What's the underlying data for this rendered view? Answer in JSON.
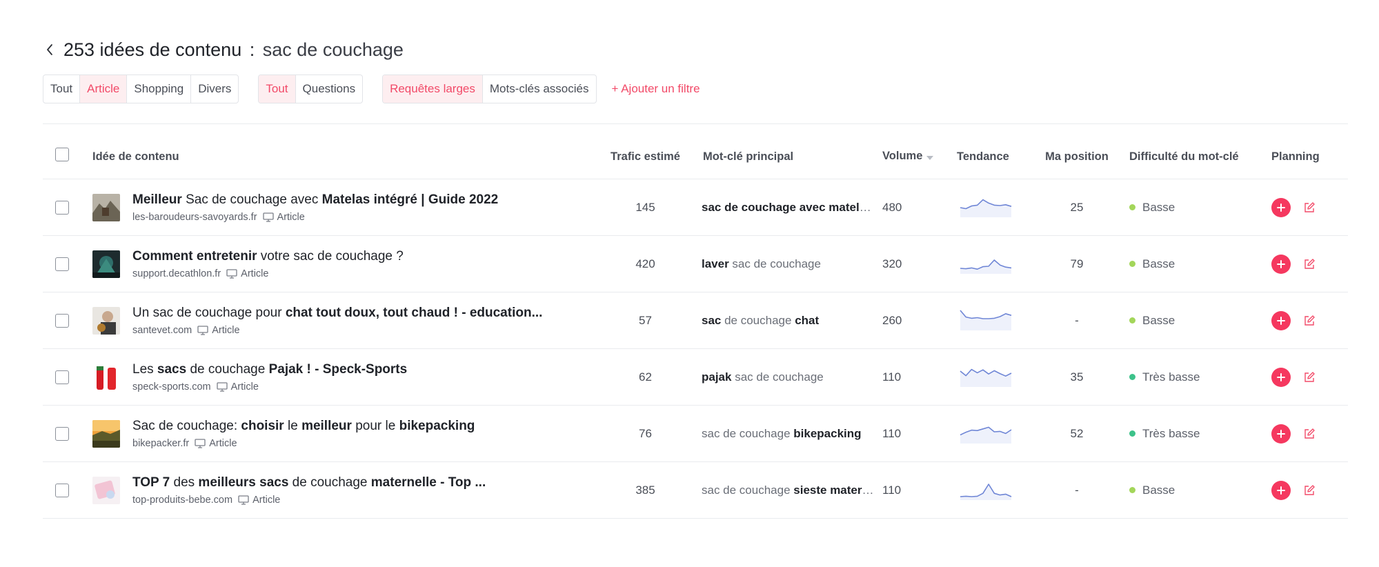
{
  "header": {
    "count": "253 idées de contenu",
    "separator": ":",
    "query": "sac de couchage"
  },
  "filters": {
    "type_group": [
      {
        "label": "Tout",
        "active": false
      },
      {
        "label": "Article",
        "active": true
      },
      {
        "label": "Shopping",
        "active": false
      },
      {
        "label": "Divers",
        "active": false
      }
    ],
    "question_group": [
      {
        "label": "Tout",
        "active": true
      },
      {
        "label": "Questions",
        "active": false
      }
    ],
    "scope_group": [
      {
        "label": "Requêtes larges",
        "active": true
      },
      {
        "label": "Mots-clés associés",
        "active": false
      }
    ],
    "add_filter": "+ Ajouter un filtre"
  },
  "columns": {
    "idea": "Idée de contenu",
    "traffic": "Trafic estimé",
    "keyword": "Mot-clé principal",
    "volume": "Volume",
    "trend": "Tendance",
    "position": "Ma position",
    "difficulty": "Difficulté du mot-clé",
    "planning": "Planning"
  },
  "colors": {
    "accent": "#f24a68",
    "plan_button": "#f5385f",
    "trend_line": "#6f86d6",
    "trend_fill": "#eef1fb",
    "low": "#a3d65a",
    "very_low": "#3dc28a"
  },
  "rows": [
    {
      "title_parts": [
        [
          "Meilleur",
          true
        ],
        [
          " Sac de couchage avec ",
          false
        ],
        [
          "Matelas intégré | Guide 2022",
          true
        ]
      ],
      "site": "les-baroudeurs-savoyards.fr",
      "type": "Article",
      "traffic": "145",
      "keyword_parts": [
        [
          "sac de couchage avec matelas...",
          true
        ]
      ],
      "volume": "480",
      "trend": [
        40,
        35,
        48,
        52,
        78,
        62,
        52,
        50,
        54,
        46
      ],
      "position": "25",
      "difficulty": "Basse",
      "difficulty_level": "low",
      "thumb": "thumb-mountain"
    },
    {
      "title_parts": [
        [
          "Comment entretenir",
          true
        ],
        [
          " votre sac de couchage ?",
          false
        ]
      ],
      "site": "support.decathlon.fr",
      "type": "Article",
      "traffic": "420",
      "keyword_parts": [
        [
          "laver",
          true
        ],
        [
          " sac de couchage",
          false
        ]
      ],
      "volume": "320",
      "trend": [
        20,
        18,
        22,
        16,
        28,
        30,
        60,
        36,
        26,
        22
      ],
      "position": "79",
      "difficulty": "Basse",
      "difficulty_level": "low",
      "thumb": "thumb-tent"
    },
    {
      "title_parts": [
        [
          "Un sac de couchage pour ",
          false
        ],
        [
          "chat tout doux, tout chaud ! - education...",
          true
        ]
      ],
      "site": "santevet.com",
      "type": "Article",
      "traffic": "57",
      "keyword_parts": [
        [
          "sac",
          true
        ],
        [
          " de couchage ",
          false
        ],
        [
          "chat",
          true
        ]
      ],
      "volume": "260",
      "trend": [
        90,
        58,
        52,
        55,
        50,
        50,
        52,
        60,
        74,
        66
      ],
      "position": "-",
      "difficulty": "Basse",
      "difficulty_level": "low",
      "thumb": "thumb-person"
    },
    {
      "title_parts": [
        [
          "Les ",
          false
        ],
        [
          "sacs",
          true
        ],
        [
          " de couchage ",
          false
        ],
        [
          "Pajak ! - Speck-Sports",
          true
        ]
      ],
      "site": "speck-sports.com",
      "type": "Article",
      "traffic": "62",
      "keyword_parts": [
        [
          "pajak",
          true
        ],
        [
          " sac de couchage",
          false
        ]
      ],
      "volume": "110",
      "trend": [
        70,
        48,
        78,
        62,
        76,
        56,
        72,
        58,
        46,
        60
      ],
      "position": "35",
      "difficulty": "Très basse",
      "difficulty_level": "very_low",
      "thumb": "thumb-red"
    },
    {
      "title_parts": [
        [
          "Sac de couchage: ",
          false
        ],
        [
          "choisir",
          true
        ],
        [
          " le ",
          false
        ],
        [
          "meilleur",
          true
        ],
        [
          " pour le ",
          false
        ],
        [
          "bikepacking",
          true
        ]
      ],
      "site": "bikepacker.fr",
      "type": "Article",
      "traffic": "76",
      "keyword_parts": [
        [
          "sac de couchage ",
          false
        ],
        [
          "bikepacking",
          true
        ]
      ],
      "volume": "110",
      "trend": [
        35,
        48,
        58,
        56,
        64,
        72,
        50,
        52,
        42,
        60
      ],
      "position": "52",
      "difficulty": "Très basse",
      "difficulty_level": "very_low",
      "thumb": "thumb-sunset"
    },
    {
      "title_parts": [
        [
          "TOP 7",
          true
        ],
        [
          " des ",
          false
        ],
        [
          "meilleurs sacs",
          true
        ],
        [
          " de couchage ",
          false
        ],
        [
          "maternelle - Top ...",
          true
        ]
      ],
      "site": "top-produits-bebe.com",
      "type": "Article",
      "traffic": "385",
      "keyword_parts": [
        [
          "sac de couchage ",
          false
        ],
        [
          "sieste maternelle",
          true
        ]
      ],
      "volume": "110",
      "trend": [
        10,
        12,
        10,
        12,
        26,
        70,
        26,
        18,
        22,
        10
      ],
      "position": "-",
      "difficulty": "Basse",
      "difficulty_level": "low",
      "thumb": "thumb-pink"
    }
  ]
}
